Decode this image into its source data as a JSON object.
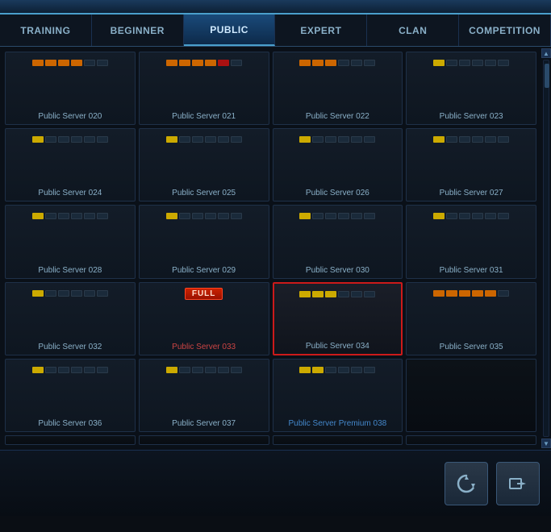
{
  "topBar": {},
  "tabs": {
    "items": [
      {
        "id": "training",
        "label": "Training",
        "active": false
      },
      {
        "id": "beginner",
        "label": "Beginner",
        "active": false
      },
      {
        "id": "public",
        "label": "Public",
        "active": true
      },
      {
        "id": "expert",
        "label": "Expert",
        "active": false
      },
      {
        "id": "clan",
        "label": "Clan",
        "active": false
      },
      {
        "id": "competition",
        "label": "Competition",
        "active": false
      }
    ]
  },
  "servers": [
    {
      "id": "020",
      "name": "Public Server 020",
      "load": [
        3,
        3,
        3,
        3,
        0,
        0
      ],
      "full": false,
      "selected": false,
      "empty": false,
      "premium": false
    },
    {
      "id": "021",
      "name": "Public Server 021",
      "load": [
        3,
        3,
        3,
        3,
        1,
        0
      ],
      "full": false,
      "selected": false,
      "empty": false,
      "premium": false
    },
    {
      "id": "022",
      "name": "Public Server 022",
      "load": [
        3,
        3,
        3,
        0,
        0,
        0
      ],
      "full": false,
      "selected": false,
      "empty": false,
      "premium": false
    },
    {
      "id": "023",
      "name": "Public Server 023",
      "load": [
        2,
        0,
        0,
        0,
        0,
        0
      ],
      "full": false,
      "selected": false,
      "empty": false,
      "premium": false
    },
    {
      "id": "024",
      "name": "Public Server 024",
      "load": [
        2,
        0,
        0,
        0,
        0,
        0
      ],
      "full": false,
      "selected": false,
      "empty": false,
      "premium": false
    },
    {
      "id": "025",
      "name": "Public Server 025",
      "load": [
        3,
        0,
        0,
        0,
        0,
        0
      ],
      "full": false,
      "selected": false,
      "empty": false,
      "premium": false
    },
    {
      "id": "026",
      "name": "Public Server 026",
      "load": [
        2,
        0,
        0,
        0,
        0,
        0
      ],
      "full": false,
      "selected": false,
      "empty": false,
      "premium": false
    },
    {
      "id": "027",
      "name": "Public Server 027",
      "load": [
        2,
        0,
        0,
        0,
        0,
        0
      ],
      "full": false,
      "selected": false,
      "empty": false,
      "premium": false
    },
    {
      "id": "028",
      "name": "Public Server 028",
      "load": [
        2,
        0,
        0,
        0,
        0,
        0
      ],
      "full": false,
      "selected": false,
      "empty": false,
      "premium": false
    },
    {
      "id": "029",
      "name": "Public Server 029",
      "load": [
        3,
        0,
        0,
        0,
        0,
        0
      ],
      "full": false,
      "selected": false,
      "empty": false,
      "premium": false
    },
    {
      "id": "030",
      "name": "Public Server 030",
      "load": [
        2,
        0,
        0,
        0,
        0,
        0
      ],
      "full": false,
      "selected": false,
      "empty": false,
      "premium": false
    },
    {
      "id": "031",
      "name": "Public Server 031",
      "load": [
        2,
        0,
        0,
        0,
        0,
        0
      ],
      "full": false,
      "selected": false,
      "empty": false,
      "premium": false
    },
    {
      "id": "032",
      "name": "Public Server 032",
      "load": [
        2,
        0,
        0,
        0,
        0,
        0
      ],
      "full": false,
      "selected": false,
      "empty": false,
      "premium": false
    },
    {
      "id": "033",
      "name": "Public Server 033",
      "load": [],
      "full": true,
      "selected": false,
      "empty": false,
      "premium": false
    },
    {
      "id": "034",
      "name": "Public Server 034",
      "load": [
        2,
        2,
        2,
        0,
        0,
        0
      ],
      "full": false,
      "selected": true,
      "empty": false,
      "premium": false
    },
    {
      "id": "035",
      "name": "Public Server 035",
      "load": [
        3,
        3,
        3,
        3,
        3,
        0
      ],
      "full": false,
      "selected": false,
      "empty": false,
      "premium": false
    },
    {
      "id": "036",
      "name": "Public Server 036",
      "load": [
        2,
        0,
        0,
        0,
        0,
        0
      ],
      "full": false,
      "selected": false,
      "empty": false,
      "premium": false
    },
    {
      "id": "037",
      "name": "Public Server 037",
      "load": [
        3,
        0,
        0,
        0,
        0,
        0
      ],
      "full": false,
      "selected": false,
      "empty": false,
      "premium": false
    },
    {
      "id": "038",
      "name": "Public Server Premium 038",
      "load": [
        2,
        2,
        0,
        0,
        0,
        0
      ],
      "full": false,
      "selected": false,
      "empty": false,
      "premium": true
    },
    {
      "id": "039",
      "name": "",
      "load": [],
      "full": false,
      "selected": false,
      "empty": true,
      "premium": false
    },
    {
      "id": "e1",
      "name": "",
      "load": [],
      "full": false,
      "selected": false,
      "empty": true,
      "premium": false
    },
    {
      "id": "e2",
      "name": "",
      "load": [],
      "full": false,
      "selected": false,
      "empty": true,
      "premium": false
    },
    {
      "id": "e3",
      "name": "",
      "load": [],
      "full": false,
      "selected": false,
      "empty": true,
      "premium": false
    },
    {
      "id": "e4",
      "name": "",
      "load": [],
      "full": false,
      "selected": false,
      "empty": true,
      "premium": false
    }
  ],
  "buttons": {
    "refresh": "↻",
    "enter": "▶",
    "full_label": "FULL"
  },
  "colors": {
    "accent": "#4a9fcc",
    "active_tab": "#d0eaff",
    "selected_border": "#cc1a1a",
    "premium_color": "#4488cc",
    "full_color": "#cc4444"
  }
}
